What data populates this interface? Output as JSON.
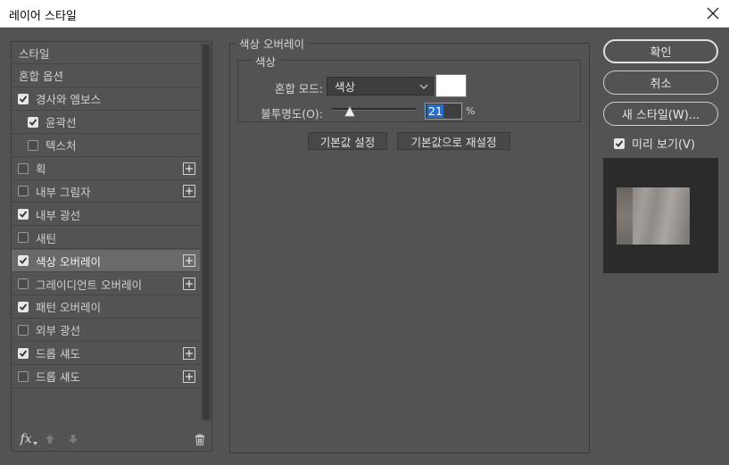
{
  "window": {
    "title": "레이어 스타일"
  },
  "styles_list": [
    {
      "label": "스타일",
      "checkbox": false,
      "checked": false,
      "indent": 0,
      "plus": false,
      "selected": false
    },
    {
      "label": "혼합 옵션",
      "checkbox": false,
      "checked": false,
      "indent": 0,
      "plus": false,
      "selected": false
    },
    {
      "label": "경사와 엠보스",
      "checkbox": true,
      "checked": true,
      "indent": 0,
      "plus": false,
      "selected": false
    },
    {
      "label": "윤곽선",
      "checkbox": true,
      "checked": true,
      "indent": 1,
      "plus": false,
      "selected": false
    },
    {
      "label": "텍스처",
      "checkbox": true,
      "checked": false,
      "indent": 1,
      "plus": false,
      "selected": false
    },
    {
      "label": "획",
      "checkbox": true,
      "checked": false,
      "indent": 0,
      "plus": true,
      "selected": false
    },
    {
      "label": "내부 그림자",
      "checkbox": true,
      "checked": false,
      "indent": 0,
      "plus": true,
      "selected": false
    },
    {
      "label": "내부 광선",
      "checkbox": true,
      "checked": true,
      "indent": 0,
      "plus": false,
      "selected": false
    },
    {
      "label": "새틴",
      "checkbox": true,
      "checked": false,
      "indent": 0,
      "plus": false,
      "selected": false
    },
    {
      "label": "색상 오버레이",
      "checkbox": true,
      "checked": true,
      "indent": 0,
      "plus": true,
      "selected": true
    },
    {
      "label": "그레이디언트 오버레이",
      "checkbox": true,
      "checked": false,
      "indent": 0,
      "plus": true,
      "selected": false
    },
    {
      "label": "패턴 오버레이",
      "checkbox": true,
      "checked": true,
      "indent": 0,
      "plus": false,
      "selected": false
    },
    {
      "label": "외부 광선",
      "checkbox": true,
      "checked": false,
      "indent": 0,
      "plus": false,
      "selected": false
    },
    {
      "label": "드롭 섀도",
      "checkbox": true,
      "checked": true,
      "indent": 0,
      "plus": true,
      "selected": false
    },
    {
      "label": "드롭 섀도",
      "checkbox": true,
      "checked": false,
      "indent": 0,
      "plus": true,
      "selected": false
    }
  ],
  "bottom_tools": {
    "fx": "fx"
  },
  "color_overlay": {
    "group_title": "색상 오버레이",
    "sub_title": "색상",
    "blend_label": "혼합 모드:",
    "blend_value": "색상",
    "color": "#ffffff",
    "opacity_label": "불투명도(O):",
    "opacity_value": "21",
    "opacity_unit": "%",
    "opacity_fraction": 0.21,
    "make_default": "기본값 설정",
    "reset_default": "기본값으로 재설정"
  },
  "buttons": {
    "ok": "확인",
    "cancel": "취소",
    "new_style": "새 스타일(W)...",
    "preview_label": "미리 보기(V)",
    "preview_checked": true
  }
}
